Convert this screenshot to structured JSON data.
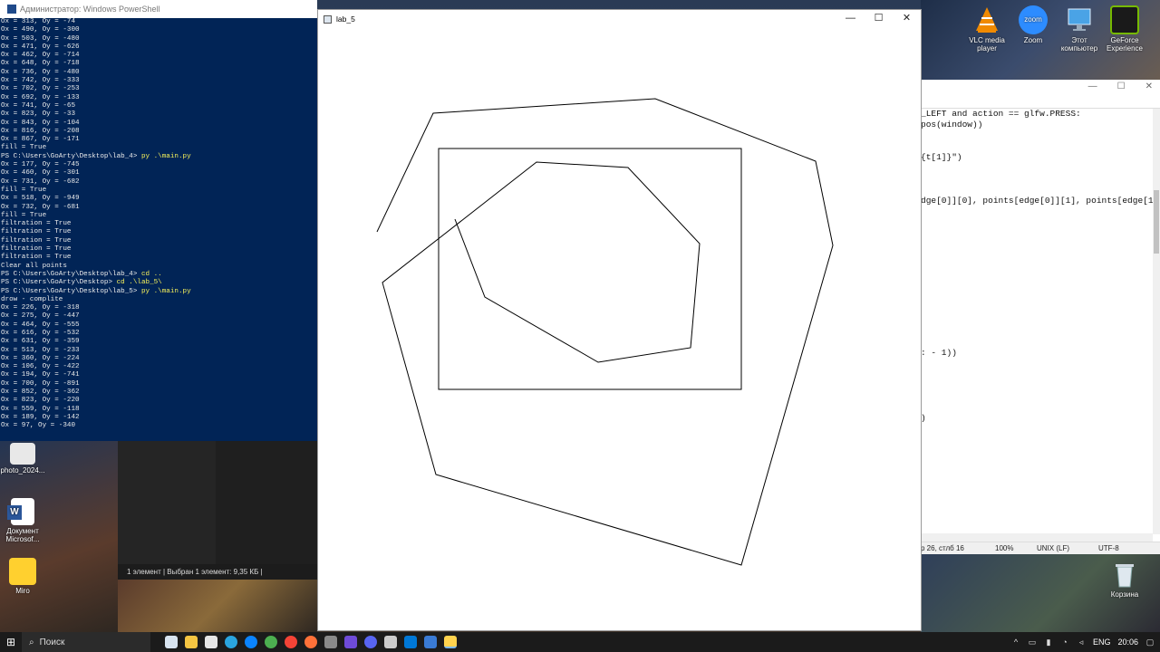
{
  "powershell": {
    "title": "Администратор: Windows PowerShell",
    "lines": [
      "Ox = 313, Oy = -74",
      "Ox = 490, Oy = -300",
      "Ox = 503, Oy = -480",
      "Ox = 471, Oy = -626",
      "Ox = 462, Oy = -714",
      "Ox = 648, Oy = -718",
      "Ox = 736, Oy = -480",
      "Ox = 742, Oy = -333",
      "Ox = 702, Oy = -253",
      "Ox = 692, Oy = -133",
      "Ox = 741, Oy = -65",
      "Ox = 823, Oy = -33",
      "Ox = 843, Oy = -104",
      "Ox = 816, Oy = -208",
      "Ox = 867, Oy = -171",
      "fill = True",
      "PS C:\\Users\\GoArty\\Desktop\\lab_4> py .\\main.py",
      "Ox = 177, Oy = -745",
      "Ox = 460, Oy = -301",
      "Ox = 731, Oy = -682",
      "fill = True",
      "Ox = 518, Oy = -949",
      "Ox = 732, Oy = -681",
      "fill = True",
      "filtration = True",
      "filtration = True",
      "filtration = True",
      "filtration = True",
      "filtration = True",
      "Clear all points",
      "PS C:\\Users\\GoArty\\Desktop\\lab_4> cd ..",
      "PS C:\\Users\\GoArty\\Desktop> cd .\\lab_5\\",
      "PS C:\\Users\\GoArty\\Desktop\\lab_5> py .\\main.py",
      "drow - complite",
      "Ox = 226, Oy = -318",
      "Ox = 275, Oy = -447",
      "Ox = 464, Oy = -555",
      "Ox = 616, Oy = -532",
      "Ox = 631, Oy = -359",
      "Ox = 513, Oy = -233",
      "Ox = 360, Oy = -224",
      "Ox = 106, Oy = -422",
      "Ox = 194, Oy = -741",
      "Ox = 700, Oy = -891",
      "Ox = 852, Oy = -362",
      "Ox = 823, Oy = -220",
      "Ox = 559, Oy = -118",
      "Ox = 189, Oy = -142",
      "Ox = 97, Oy = -340"
    ]
  },
  "explorer": {
    "status": "1 элемент  |  Выбран 1 элемент: 9,35 КБ  |"
  },
  "editor": {
    "code_lines": [
      "_LEFT and action == glfw.PRESS:",
      "pos(window))",
      "",
      "{t[1]}\")",
      "",
      "dge[0]][0], points[edge[0]][1], points[edge[1]][0",
      "",
      ": - 1))",
      ")"
    ],
    "status_pos": "р 26, стлб 16",
    "status_zoom": "100%",
    "status_eol": "UNIX (LF)",
    "status_enc": "UTF-8"
  },
  "desktop_icons": [
    {
      "label": "VLC media player",
      "color": "#f08a00"
    },
    {
      "label": "Zoom",
      "color": "#2d8cff"
    },
    {
      "label": "Этот компьютер",
      "color": "#4aa3e6"
    },
    {
      "label": "GeForce Experience",
      "color": "#76b900"
    },
    {
      "label": "photo_2024...",
      "color": "#e8e8e8"
    },
    {
      "label": "Документ Microsof...",
      "color": "#2b579a"
    },
    {
      "label": "Miro",
      "color": "#ffd02f"
    },
    {
      "label": "Корзина",
      "color": "#cfd8e0"
    }
  ],
  "lab_window": {
    "title": "lab_5",
    "minimize": "—",
    "maximize": "☐",
    "close": "✕"
  },
  "taskbar": {
    "search_placeholder": "Поиск",
    "lang": "ENG",
    "time": "20:06"
  }
}
